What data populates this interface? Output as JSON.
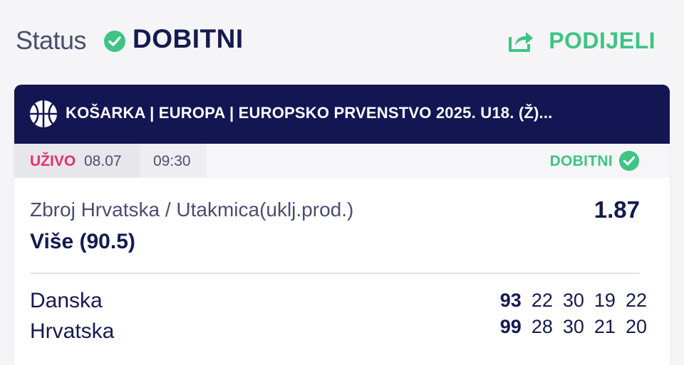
{
  "status": {
    "label": "Status",
    "value": "DOBITNI",
    "icon": "check-circle-icon",
    "color": "#3ec483"
  },
  "share": {
    "label": "PODIJELI",
    "icon": "share-icon"
  },
  "event": {
    "sport_icon": "basketball-icon",
    "title": "KOŠARKA | EUROPA | EUROPSKO PRVENSTVO 2025. U18. (Ž)...",
    "live_label": "UŽIVO",
    "date": "08.07",
    "time": "09:30",
    "result": "DOBITNI"
  },
  "bet": {
    "market": "Zbroj Hrvatska / Utakmica(uklj.prod.)",
    "selection": "Više (90.5)",
    "odds": "1.87"
  },
  "teams": [
    {
      "name": "Danska",
      "total": "93",
      "quarters": [
        "22",
        "30",
        "19",
        "22"
      ]
    },
    {
      "name": "Hrvatska",
      "total": "99",
      "quarters": [
        "28",
        "30",
        "21",
        "20"
      ]
    }
  ],
  "colors": {
    "navy": "#131652",
    "text": "#151a4e",
    "muted": "#4a4d70",
    "green": "#3ec483",
    "live": "#e3316b"
  }
}
